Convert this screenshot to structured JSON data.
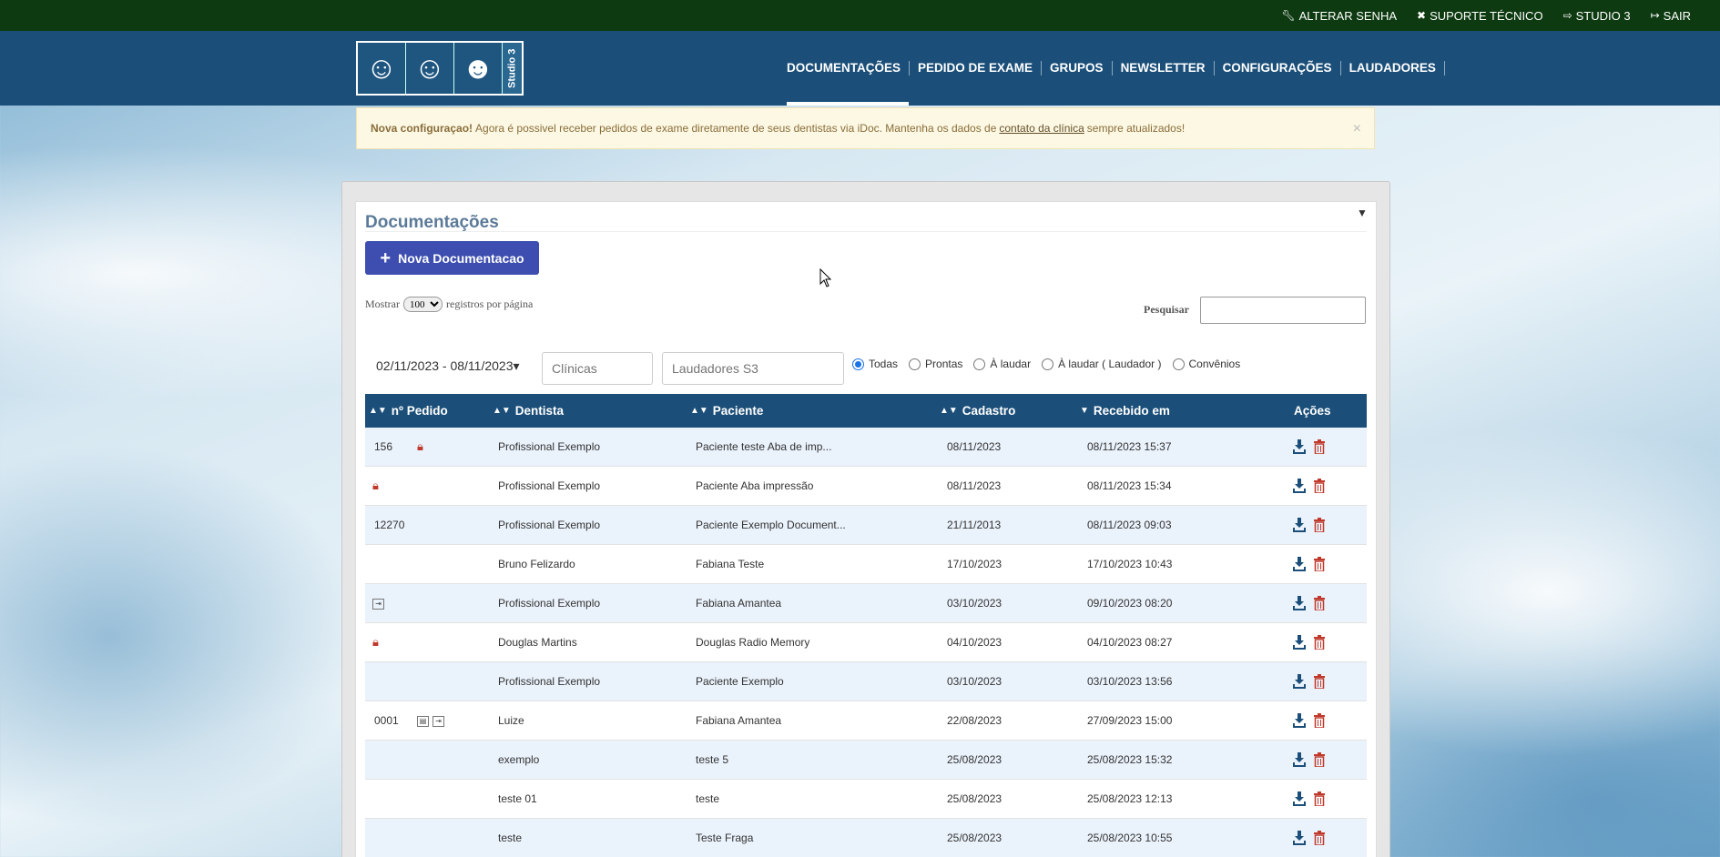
{
  "topbar": {
    "links": [
      {
        "icon": "wrench-icon",
        "label": "ALTERAR SENHA"
      },
      {
        "icon": "tools-icon",
        "label": "SUPORTE TÉCNICO"
      },
      {
        "icon": "arrow-right-icon",
        "label": "STUDIO 3"
      },
      {
        "icon": "sign-out-icon",
        "label": "SAIR"
      }
    ]
  },
  "logo": {
    "brand": "Studio 3"
  },
  "nav": {
    "items": [
      "DOCUMENTAÇÕES",
      "PEDIDO DE EXAME",
      "GRUPOS",
      "NEWSLETTER",
      "CONFIGURAÇÕES",
      "LAUDADORES"
    ],
    "active": "DOCUMENTAÇÕES"
  },
  "alert": {
    "strong": "Nova configuraçao!",
    "text": "Agora é possivel receber pedidos de exame diretamente de seus dentistas via iDoc. Mantenha os dados de",
    "link": "contato da clínica",
    "tail": "sempre atualizados!",
    "close": "×",
    "bg_color": "#fcf8e3"
  },
  "panel": {
    "title": "Documentações",
    "new_button": "Nova Documentacao",
    "show_prefix": "Mostrar",
    "page_size": "100",
    "show_suffix": "registros por página",
    "search_label": "Pesquisar",
    "search_value": ""
  },
  "filters": {
    "date_range": "02/11/2023 - 08/11/2023",
    "clinicas_placeholder": "Clínicas",
    "laudadores_placeholder": "Laudadores S3",
    "status_options": [
      "Todas",
      "Prontas",
      "À laudar",
      "À laudar ( Laudador )",
      "Convênios"
    ],
    "selected_status": "Todas"
  },
  "table": {
    "header_color": "#1b4f79",
    "columns": [
      "nº Pedido",
      "Dentista",
      "Paciente",
      "Cadastro",
      "Recebido em",
      "Ações"
    ],
    "rows": [
      {
        "pedido": "156",
        "flags": [
          "lock"
        ],
        "dentista": "Profissional Exemplo",
        "paciente": "Paciente teste Aba de imp...",
        "cadastro": "08/11/2023",
        "recebido": "08/11/2023 15:37"
      },
      {
        "pedido": "",
        "flags": [
          "lock"
        ],
        "dentista": "Profissional Exemplo",
        "paciente": "Paciente Aba impressão",
        "cadastro": "08/11/2023",
        "recebido": "08/11/2023 15:34"
      },
      {
        "pedido": "12270",
        "flags": [],
        "dentista": "Profissional Exemplo",
        "paciente": "Paciente Exemplo Document...",
        "cadastro": "21/11/2013",
        "recebido": "08/11/2023 09:03"
      },
      {
        "pedido": "",
        "flags": [],
        "dentista": "Bruno Felizardo",
        "paciente": "Fabiana Teste",
        "cadastro": "17/10/2023",
        "recebido": "17/10/2023 10:43"
      },
      {
        "pedido": "",
        "flags": [
          "import"
        ],
        "dentista": "Profissional Exemplo",
        "paciente": "Fabiana Amantea",
        "cadastro": "03/10/2023",
        "recebido": "09/10/2023 08:20"
      },
      {
        "pedido": "",
        "flags": [
          "lock"
        ],
        "dentista": "Douglas Martins",
        "paciente": "Douglas Radio Memory",
        "cadastro": "04/10/2023",
        "recebido": "04/10/2023 08:27"
      },
      {
        "pedido": "",
        "flags": [],
        "dentista": "Profissional Exemplo",
        "paciente": "Paciente Exemplo",
        "cadastro": "03/10/2023",
        "recebido": "03/10/2023 13:56"
      },
      {
        "pedido": "0001",
        "flags": [
          "doc",
          "import"
        ],
        "dentista": "Luize",
        "paciente": "Fabiana Amantea",
        "cadastro": "22/08/2023",
        "recebido": "27/09/2023 15:00"
      },
      {
        "pedido": "",
        "flags": [],
        "dentista": "exemplo",
        "paciente": "teste 5",
        "cadastro": "25/08/2023",
        "recebido": "25/08/2023 15:32"
      },
      {
        "pedido": "",
        "flags": [],
        "dentista": "teste 01",
        "paciente": "teste",
        "cadastro": "25/08/2023",
        "recebido": "25/08/2023 12:13"
      },
      {
        "pedido": "",
        "flags": [],
        "dentista": "teste",
        "paciente": "Teste Fraga",
        "cadastro": "25/08/2023",
        "recebido": "25/08/2023 10:55"
      }
    ]
  }
}
